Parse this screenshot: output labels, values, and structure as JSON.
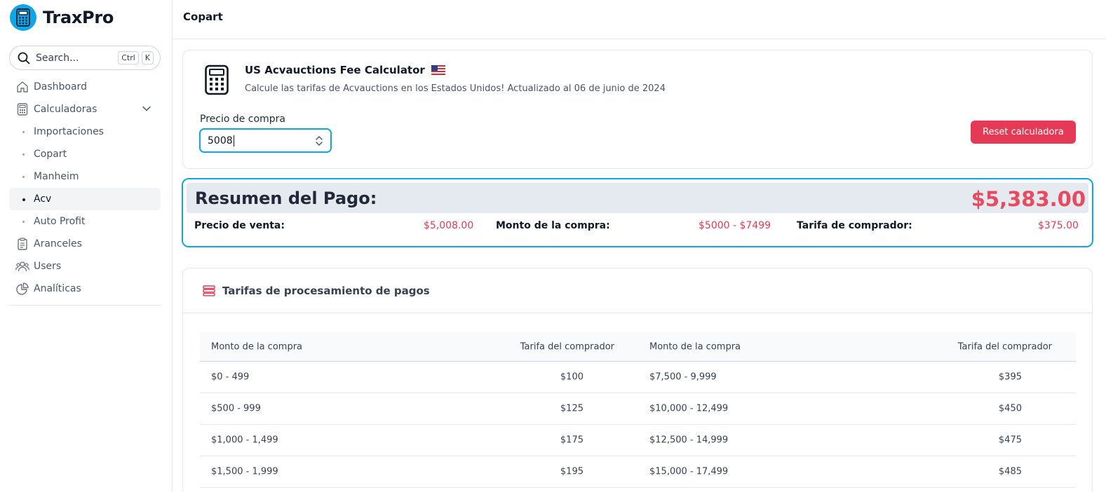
{
  "app": {
    "name": "TraxPro",
    "brand_color": "#0ea5e9",
    "accent_color": "#e63956"
  },
  "search": {
    "label": "Search...",
    "shortcut_ctrl": "Ctrl",
    "shortcut_key": "K"
  },
  "sidebar": {
    "items": [
      {
        "label": "Dashboard",
        "icon": "home-icon"
      },
      {
        "label": "Calculadoras",
        "icon": "calculator-icon",
        "expanded": true
      },
      {
        "label": "Aranceles",
        "icon": "clipboard-icon"
      },
      {
        "label": "Users",
        "icon": "users-icon"
      },
      {
        "label": "Analíticas",
        "icon": "pie-chart-icon"
      }
    ],
    "sub_items": [
      {
        "label": "Importaciones",
        "active": false
      },
      {
        "label": "Copart",
        "active": false
      },
      {
        "label": "Manheim",
        "active": false
      },
      {
        "label": "Acv",
        "active": true
      },
      {
        "label": "Auto Profit",
        "active": false
      }
    ]
  },
  "header": {
    "title": "Copart"
  },
  "calculator": {
    "title": "US Acvauctions Fee Calculator",
    "flag": "us-flag-icon",
    "subtitle": "Calcule las tarifas de Acvauctions en los Estados Unidos! Actualizado al 06 de junio de 2024",
    "price_label": "Precio de compra",
    "price_value": "5008",
    "reset_label": "Reset calculadora"
  },
  "summary": {
    "title": "Resumen del Pago:",
    "total": "$5,383.00",
    "sale_price_label": "Precio de venta:",
    "sale_price_value": "$5,008.00",
    "purchase_range_label": "Monto de la compra:",
    "purchase_range_value": "$5000 - $7499",
    "buyer_fee_label": "Tarifa de comprador:",
    "buyer_fee_value": "$375.00"
  },
  "fees": {
    "title": "Tarifas de procesamiento de pagos",
    "columns": [
      "Monto de la compra",
      "Tarifa del comprador",
      "Monto de la compra",
      "Tarifa del comprador"
    ],
    "rows": [
      [
        "$0 - 499",
        "$100",
        "$7,500 - 9,999",
        "$395"
      ],
      [
        "$500 - 999",
        "$125",
        "$10,000 - 12,499",
        "$450"
      ],
      [
        "$1,000 - 1,499",
        "$175",
        "$12,500 - 14,999",
        "$475"
      ],
      [
        "$1,500 - 1,999",
        "$195",
        "$15,000 - 17,499",
        "$485"
      ]
    ]
  }
}
